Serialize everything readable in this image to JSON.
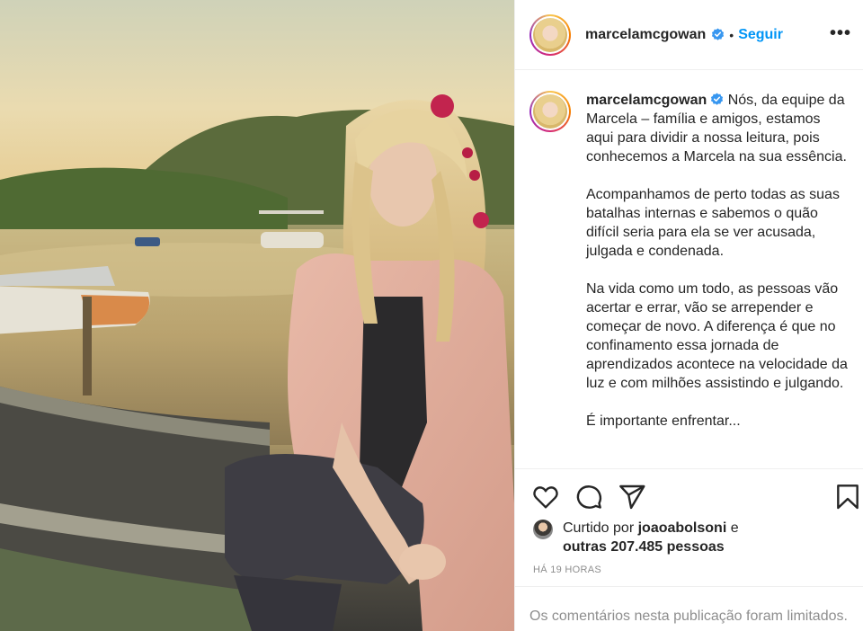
{
  "post": {
    "image_alt": "Foto de mulher loira sentada em um barco à beira de um rio ao pôr do sol",
    "username": "marcelamcgowan",
    "verified_icon": "verified-badge-icon",
    "separator": "•",
    "follow_label": "Seguir",
    "more_icon": "more-options-icon",
    "more_label": "•••"
  },
  "caption": {
    "username": "marcelamcgowan",
    "text": " Nós, da equipe da Marcela – família e amigos, estamos aqui para dividir a nossa leitura, pois conhecemos a Marcela na sua essência.\n\nAcompanhamos de perto todas as suas batalhas internas e sabemos o quão difícil seria para ela se ver acusada, julgada e condenada.\n\nNa vida como um todo, as pessoas vão acertar e errar, vão se arrepender e começar de novo. A diferença é que no confinamento essa jornada de aprendizados acontece na velocidade da luz e com milhões assistindo e julgando.\n\nÉ importante enfrentar..."
  },
  "actions": {
    "like_icon": "heart-icon",
    "comment_icon": "comment-icon",
    "share_icon": "share-icon",
    "save_icon": "bookmark-icon"
  },
  "likes": {
    "prefix": "Curtido por ",
    "user": "joaoabolsoni",
    "conj": " e",
    "others": "outras 207.485 pessoas"
  },
  "timestamp": "HÁ 19 HORAS",
  "comments_notice": "Os comentários nesta publicação foram limitados.",
  "colors": {
    "link_blue": "#0095f6",
    "text": "#262626",
    "muted": "#8e8e8e",
    "border": "#efefef"
  }
}
